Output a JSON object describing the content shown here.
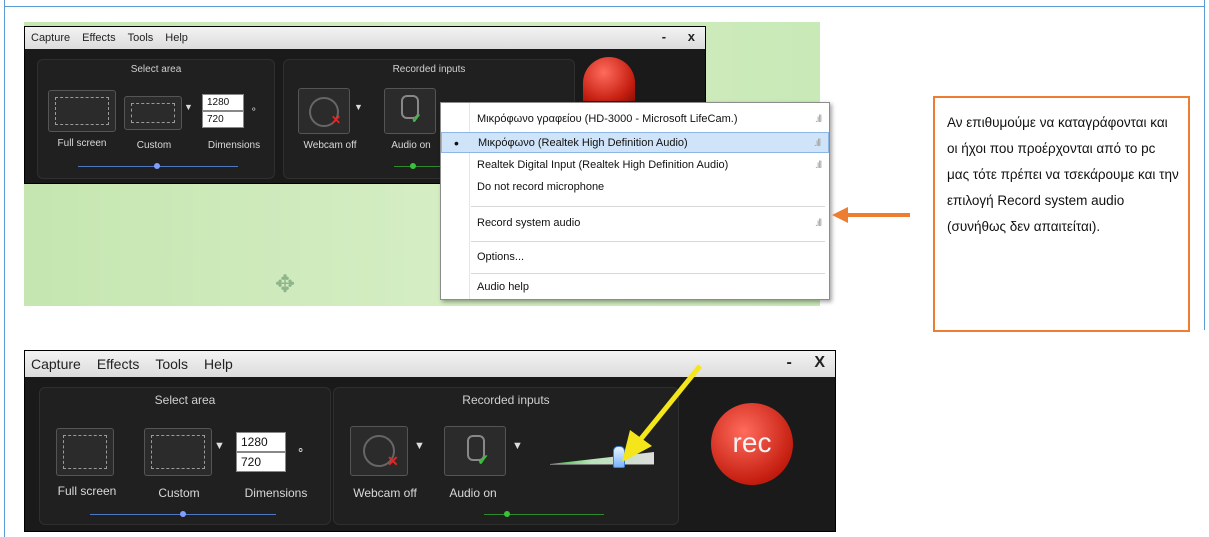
{
  "top_heading_fragment": "",
  "recorder_top": {
    "menu": [
      "Capture",
      "Effects",
      "Tools",
      "Help"
    ],
    "window_buttons": [
      "-",
      "x"
    ],
    "select_area_title": "Select area",
    "recorded_inputs_title": "Recorded inputs",
    "full_screen_label": "Full screen",
    "custom_label": "Custom",
    "dimensions_label": "Dimensions",
    "width_value": "1280",
    "height_value": "720",
    "webcam_label": "Webcam off",
    "audio_label": "Audio on"
  },
  "audio_menu": {
    "items": [
      {
        "label": "Μικρόφωνο γραφείου (HD-3000 - Microsoft LifeCam.)",
        "selected": false
      },
      {
        "label": "Μικρόφωνο (Realtek High Definition Audio)",
        "selected": true
      },
      {
        "label": "Realtek Digital Input (Realtek High Definition Audio)",
        "selected": false
      },
      {
        "label": "Do not record microphone",
        "selected": false
      }
    ],
    "record_system_audio": "Record system audio",
    "options": "Options...",
    "audio_help": "Audio help",
    "signal_glyph": ".ıll"
  },
  "annotation": {
    "text": "Αν επιθυμούμε να καταγράφονται και οι ήχοι που προέρχονται από το pc μας τότε πρέπει να τσεκάρουμε και την επιλογή Record system audio (συνήθως δεν απαιτείται)."
  },
  "recorder_bottom": {
    "menu": [
      "Capture",
      "Effects",
      "Tools",
      "Help"
    ],
    "window_buttons": [
      "-",
      "X"
    ],
    "select_area_title": "Select area",
    "recorded_inputs_title": "Recorded inputs",
    "full_screen_label": "Full screen",
    "custom_label": "Custom",
    "dimensions_label": "Dimensions",
    "width_value": "1280",
    "height_value": "720",
    "webcam_label": "Webcam off",
    "audio_label": "Audio on",
    "rec_label": "rec",
    "audio_level": 0.65
  },
  "colors": {
    "annotation_border": "#ed7d31",
    "arrow_orange": "#ed7d31",
    "arrow_yellow": "#f5e51b",
    "rec_red": "#d62a1b"
  }
}
